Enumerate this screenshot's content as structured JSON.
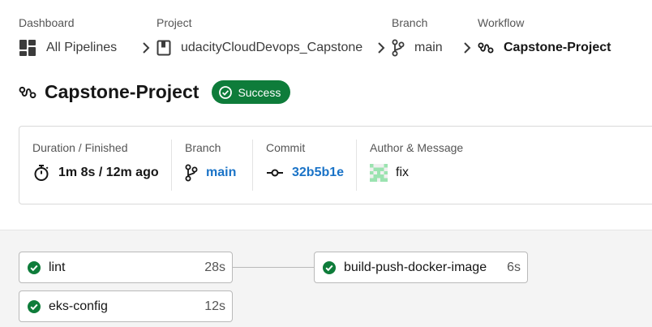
{
  "breadcrumb": {
    "dashboard": {
      "label": "Dashboard",
      "value": "All Pipelines"
    },
    "project": {
      "label": "Project",
      "value": "udacityCloudDevops_Capstone"
    },
    "branch": {
      "label": "Branch",
      "value": "main"
    },
    "workflow": {
      "label": "Workflow",
      "value": "Capstone-Project"
    }
  },
  "header": {
    "title": "Capstone-Project",
    "status": "Success"
  },
  "info": {
    "duration_label": "Duration / Finished",
    "duration_value": "1m 8s / 12m ago",
    "branch_label": "Branch",
    "branch_value": "main",
    "commit_label": "Commit",
    "commit_value": "32b5b1e",
    "author_label": "Author & Message",
    "message": "fix"
  },
  "jobs": [
    {
      "name": "lint",
      "duration": "28s",
      "status": "success"
    },
    {
      "name": "eks-config",
      "duration": "12s",
      "status": "success"
    },
    {
      "name": "build-push-docker-image",
      "duration": "6s",
      "status": "success"
    }
  ],
  "colors": {
    "success": "#0e7c3a",
    "link": "#1a73c7"
  },
  "icons": {
    "dashboard": "grid-icon",
    "project": "book-icon",
    "branch": "git-branch-icon",
    "workflow": "workflow-icon",
    "duration": "stopwatch-icon",
    "commit": "git-commit-icon",
    "status": "check-circle-icon"
  }
}
